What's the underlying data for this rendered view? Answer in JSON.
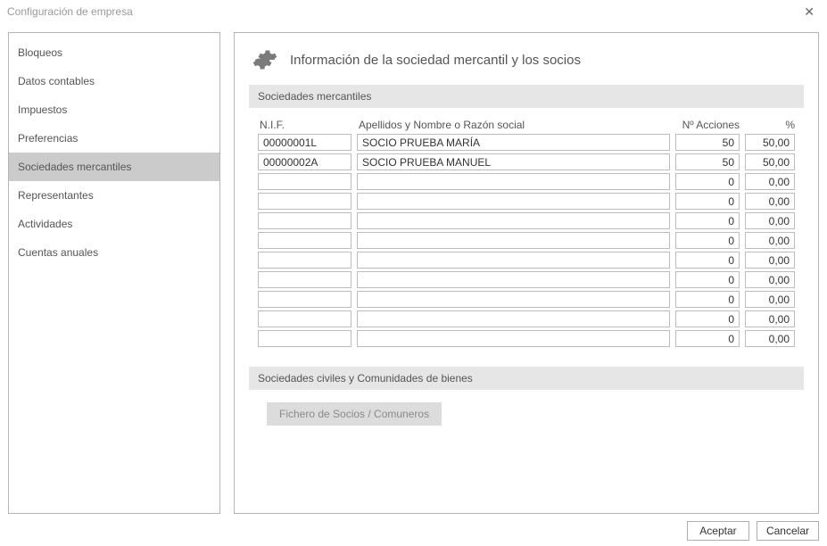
{
  "window": {
    "title": "Configuración de empresa"
  },
  "sidebar": {
    "items": [
      {
        "label": "Bloqueos"
      },
      {
        "label": "Datos contables"
      },
      {
        "label": "Impuestos"
      },
      {
        "label": "Preferencias"
      },
      {
        "label": "Sociedades mercantiles"
      },
      {
        "label": "Representantes"
      },
      {
        "label": "Actividades"
      },
      {
        "label": "Cuentas anuales"
      }
    ],
    "selected_index": 4
  },
  "main": {
    "title": "Información de la sociedad mercantil y los socios",
    "section1": "Sociedades mercantiles",
    "section2": "Sociedades civiles y Comunidades de bienes",
    "fichero_button": "Fichero de Socios / Comuneros",
    "columns": {
      "nif": "N.I.F.",
      "name": "Apellidos y Nombre o Razón social",
      "acciones": "Nº Acciones",
      "pct": "%"
    },
    "rows": [
      {
        "nif": "00000001L",
        "name": "SOCIO PRUEBA MARÍA",
        "acciones": "50",
        "pct": "50,00"
      },
      {
        "nif": "00000002A",
        "name": "SOCIO PRUEBA MANUEL",
        "acciones": "50",
        "pct": "50,00"
      },
      {
        "nif": "",
        "name": "",
        "acciones": "0",
        "pct": "0,00"
      },
      {
        "nif": "",
        "name": "",
        "acciones": "0",
        "pct": "0,00"
      },
      {
        "nif": "",
        "name": "",
        "acciones": "0",
        "pct": "0,00"
      },
      {
        "nif": "",
        "name": "",
        "acciones": "0",
        "pct": "0,00"
      },
      {
        "nif": "",
        "name": "",
        "acciones": "0",
        "pct": "0,00"
      },
      {
        "nif": "",
        "name": "",
        "acciones": "0",
        "pct": "0,00"
      },
      {
        "nif": "",
        "name": "",
        "acciones": "0",
        "pct": "0,00"
      },
      {
        "nif": "",
        "name": "",
        "acciones": "0",
        "pct": "0,00"
      },
      {
        "nif": "",
        "name": "",
        "acciones": "0",
        "pct": "0,00"
      }
    ]
  },
  "footer": {
    "accept": "Aceptar",
    "cancel": "Cancelar"
  }
}
